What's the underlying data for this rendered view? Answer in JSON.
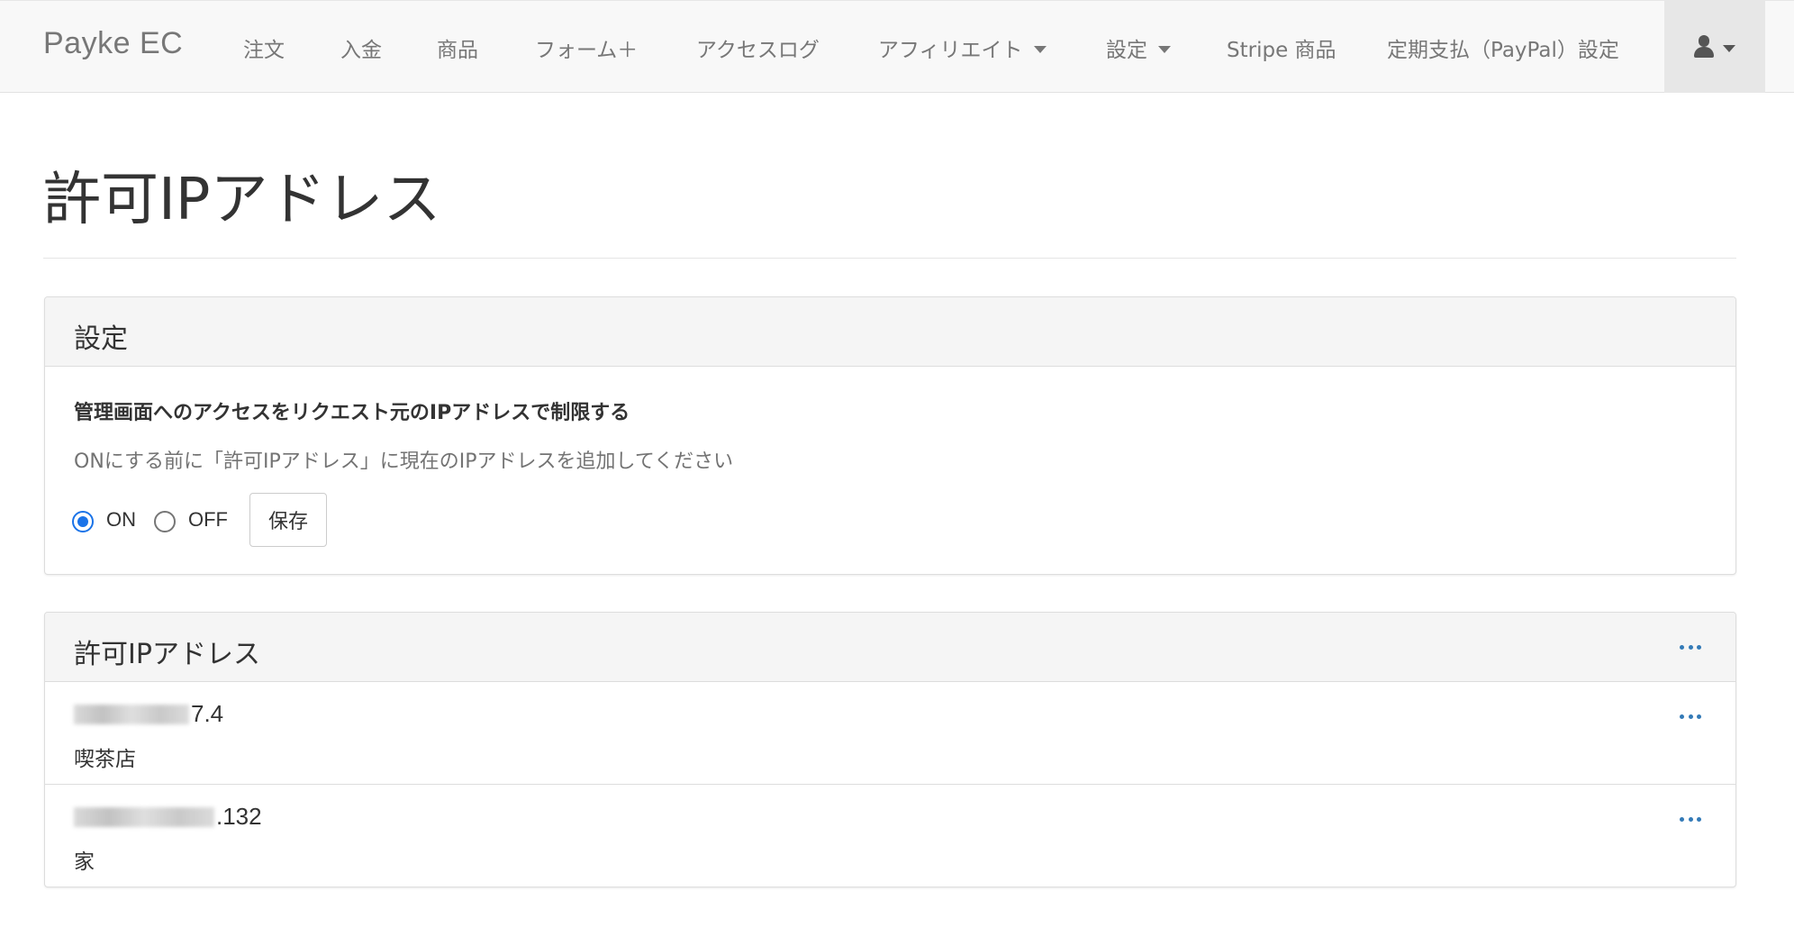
{
  "navbar": {
    "brand": "Payke EC",
    "items": [
      {
        "label": "注文"
      },
      {
        "label": "入金"
      },
      {
        "label": "商品"
      },
      {
        "label": "フォーム＋"
      },
      {
        "label": "アクセスログ"
      },
      {
        "label": "アフィリエイト",
        "dropdown": true
      },
      {
        "label": "設定",
        "dropdown": true
      },
      {
        "label": "Stripe 商品"
      },
      {
        "label": "定期支払（PayPal）設定"
      }
    ],
    "user_icon": "user-icon"
  },
  "page": {
    "title": "許可IPアドレス"
  },
  "settings_panel": {
    "title": "設定",
    "label": "管理画面へのアクセスをリクエスト元のIPアドレスで制限する",
    "help": "ONにする前に「許可IPアドレス」に現在のIPアドレスを追加してください",
    "options": [
      {
        "label": "ON",
        "checked": true
      },
      {
        "label": "OFF",
        "checked": false
      }
    ],
    "save_label": "保存"
  },
  "ip_panel": {
    "title": "許可IPアドレス",
    "menu_icon": "ellipsis-icon",
    "rows": [
      {
        "address_visible": "7.4",
        "label": "喫茶店"
      },
      {
        "address_visible": ".132",
        "label": "家"
      }
    ]
  },
  "colors": {
    "navbar_bg": "#f8f8f8",
    "nav_text": "#777777",
    "panel_heading_bg": "#f5f5f5",
    "accent": "#337ab7",
    "radio_checked": "#1a73e8"
  }
}
